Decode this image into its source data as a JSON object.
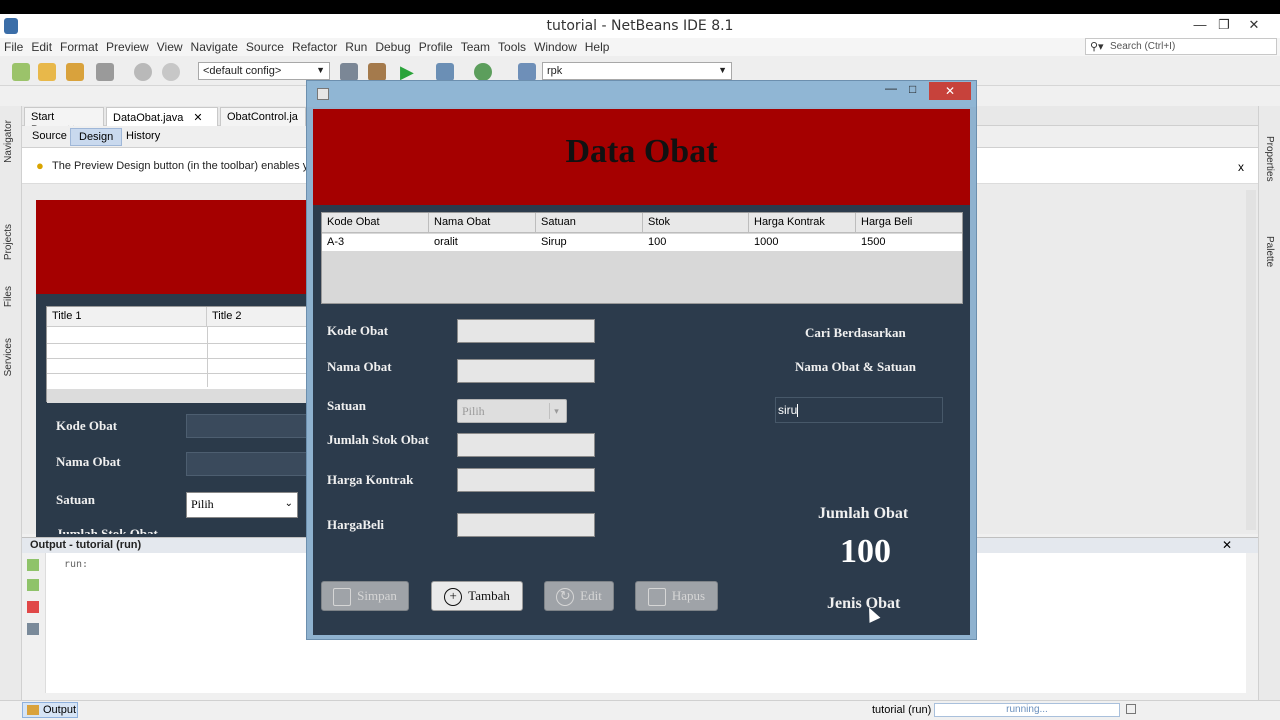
{
  "window": {
    "title": "tutorial - NetBeans IDE 8.1"
  },
  "menu": [
    "File",
    "Edit",
    "Format",
    "Preview",
    "View",
    "Navigate",
    "Source",
    "Refactor",
    "Run",
    "Debug",
    "Profile",
    "Team",
    "Tools",
    "Window",
    "Help"
  ],
  "search": {
    "placeholder": "Search (Ctrl+I)"
  },
  "toolbar": {
    "config": "<default config>",
    "project": "rpk"
  },
  "tabs": [
    {
      "label": "Start Page"
    },
    {
      "label": "DataObat.java"
    },
    {
      "label": "ObatControl.ja"
    }
  ],
  "editor": {
    "subtabs": [
      "Source",
      "Design",
      "History"
    ],
    "hint": "The Preview Design button (in the toolbar) enables you",
    "hint_close": "x"
  },
  "left_panels": [
    "Navigator",
    "Projects",
    "Files",
    "Services"
  ],
  "right_panels": [
    "Properties",
    "Palette"
  ],
  "bg_form": {
    "table_headers": [
      "Title 1",
      "Title 2"
    ],
    "labels": [
      "Kode Obat",
      "Nama Obat",
      "Satuan",
      "Jumlah Stok Obat"
    ],
    "satuan_value": "Pilih"
  },
  "output": {
    "title": "Output - tutorial (run)",
    "text": "run:"
  },
  "status": {
    "task": "tutorial (run)",
    "progress_text": "running...",
    "tab_label": "Output"
  },
  "dialog": {
    "header": "Data Obat",
    "table": {
      "headers": [
        "Kode Obat",
        "Nama Obat",
        "Satuan",
        "Stok",
        "Harga Kontrak",
        "Harga Beli"
      ],
      "rows": [
        [
          "A-3",
          "oralit",
          "Sirup",
          "100",
          "1000",
          "1500"
        ]
      ]
    },
    "form": {
      "kode": "Kode Obat",
      "nama": "Nama Obat",
      "satuan": "Satuan",
      "satuan_value": "Pilih",
      "stok": "Jumlah Stok Obat",
      "kontrak": "Harga Kontrak",
      "beli": "HargaBeli"
    },
    "search": {
      "line1": "Cari Berdasarkan",
      "line2": "Nama Obat & Satuan",
      "value": "siru"
    },
    "summary": {
      "jumlah_label": "Jumlah Obat",
      "jumlah_value": "100",
      "jenis_label": "Jenis Obat"
    },
    "buttons": {
      "simpan": "Simpan",
      "tambah": "Tambah",
      "edit": "Edit",
      "hapus": "Hapus"
    }
  },
  "colors": {
    "header_red": "#a50000",
    "form_bg": "#2c3b4c",
    "title_bar": "#90b6d4",
    "close_red": "#c7423b"
  }
}
